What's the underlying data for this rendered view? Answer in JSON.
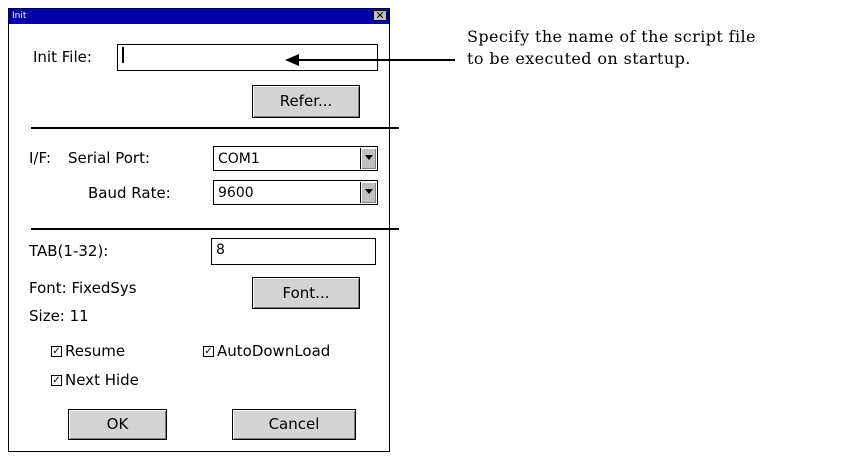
{
  "window": {
    "title": "Init",
    "close_glyph": "✕"
  },
  "init_file": {
    "label": "Init File:",
    "value": "",
    "refer_label": "Refer..."
  },
  "interface": {
    "if_label": "I/F:",
    "serial_port_label": "Serial Port:",
    "serial_port_value": "COM1",
    "baud_rate_label": "Baud Rate:",
    "baud_rate_value": "9600"
  },
  "tab": {
    "label": "TAB(1-32):",
    "value": "8"
  },
  "font": {
    "font_label": "Font: FixedSys",
    "size_label": "Size:  11",
    "button_label": "Font..."
  },
  "options": [
    {
      "label": "Resume",
      "checked": true
    },
    {
      "label": "AutoDownLoad",
      "checked": true
    },
    {
      "label": "Next Hide",
      "checked": true
    }
  ],
  "buttons": {
    "ok": "OK",
    "cancel": "Cancel"
  },
  "annotation": {
    "line1": "Specify the name of the script file",
    "line2": "to be executed on startup."
  },
  "colors": {
    "titlebar": "#0000a8",
    "button_face": "#d4d4d4"
  }
}
